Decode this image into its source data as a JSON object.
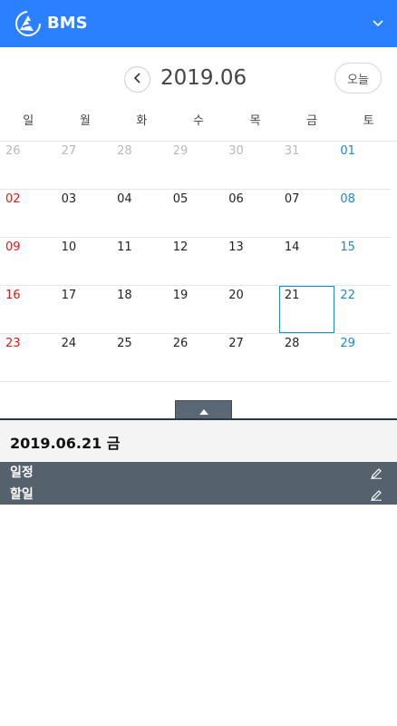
{
  "header": {
    "title": "BMS"
  },
  "calendar": {
    "month_label": "2019.06",
    "today_label": "오늘",
    "weekdays": [
      "일",
      "월",
      "화",
      "수",
      "목",
      "금",
      "토"
    ],
    "weeks": [
      [
        "26",
        "27",
        "28",
        "29",
        "30",
        "31",
        "01"
      ],
      [
        "02",
        "03",
        "04",
        "05",
        "06",
        "07",
        "08"
      ],
      [
        "09",
        "10",
        "11",
        "12",
        "13",
        "14",
        "15"
      ],
      [
        "16",
        "17",
        "18",
        "19",
        "20",
        "21",
        "22"
      ],
      [
        "23",
        "24",
        "25",
        "26",
        "27",
        "28",
        "29"
      ]
    ],
    "selected_date": "21"
  },
  "detail": {
    "date_label": "2019.06.21 금",
    "sections": [
      {
        "label": "일정"
      },
      {
        "label": "할일"
      }
    ]
  },
  "colors": {
    "header": "#2b80ff",
    "sunday": "#e01818",
    "saturday": "#1488e0",
    "section_bar": "#56616e"
  }
}
